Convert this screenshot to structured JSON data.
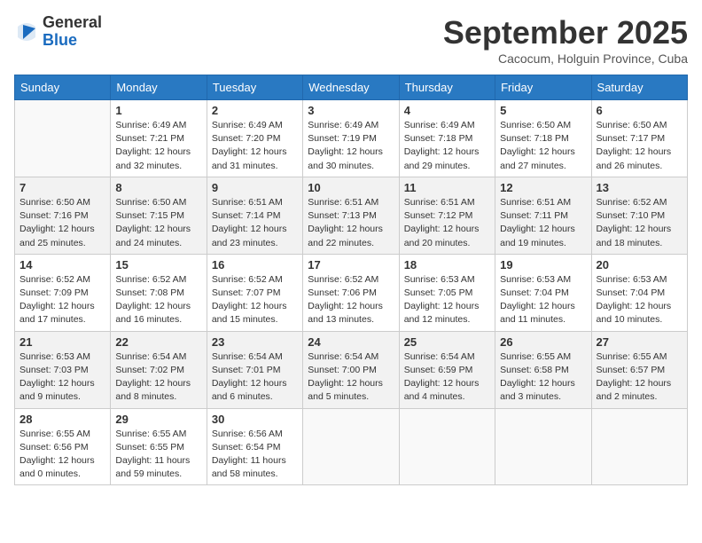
{
  "header": {
    "logo_general": "General",
    "logo_blue": "Blue",
    "month": "September 2025",
    "location": "Cacocum, Holguin Province, Cuba"
  },
  "weekdays": [
    "Sunday",
    "Monday",
    "Tuesday",
    "Wednesday",
    "Thursday",
    "Friday",
    "Saturday"
  ],
  "weeks": [
    [
      {
        "day": "",
        "info": ""
      },
      {
        "day": "1",
        "info": "Sunrise: 6:49 AM\nSunset: 7:21 PM\nDaylight: 12 hours\nand 32 minutes."
      },
      {
        "day": "2",
        "info": "Sunrise: 6:49 AM\nSunset: 7:20 PM\nDaylight: 12 hours\nand 31 minutes."
      },
      {
        "day": "3",
        "info": "Sunrise: 6:49 AM\nSunset: 7:19 PM\nDaylight: 12 hours\nand 30 minutes."
      },
      {
        "day": "4",
        "info": "Sunrise: 6:49 AM\nSunset: 7:18 PM\nDaylight: 12 hours\nand 29 minutes."
      },
      {
        "day": "5",
        "info": "Sunrise: 6:50 AM\nSunset: 7:18 PM\nDaylight: 12 hours\nand 27 minutes."
      },
      {
        "day": "6",
        "info": "Sunrise: 6:50 AM\nSunset: 7:17 PM\nDaylight: 12 hours\nand 26 minutes."
      }
    ],
    [
      {
        "day": "7",
        "info": "Sunrise: 6:50 AM\nSunset: 7:16 PM\nDaylight: 12 hours\nand 25 minutes."
      },
      {
        "day": "8",
        "info": "Sunrise: 6:50 AM\nSunset: 7:15 PM\nDaylight: 12 hours\nand 24 minutes."
      },
      {
        "day": "9",
        "info": "Sunrise: 6:51 AM\nSunset: 7:14 PM\nDaylight: 12 hours\nand 23 minutes."
      },
      {
        "day": "10",
        "info": "Sunrise: 6:51 AM\nSunset: 7:13 PM\nDaylight: 12 hours\nand 22 minutes."
      },
      {
        "day": "11",
        "info": "Sunrise: 6:51 AM\nSunset: 7:12 PM\nDaylight: 12 hours\nand 20 minutes."
      },
      {
        "day": "12",
        "info": "Sunrise: 6:51 AM\nSunset: 7:11 PM\nDaylight: 12 hours\nand 19 minutes."
      },
      {
        "day": "13",
        "info": "Sunrise: 6:52 AM\nSunset: 7:10 PM\nDaylight: 12 hours\nand 18 minutes."
      }
    ],
    [
      {
        "day": "14",
        "info": "Sunrise: 6:52 AM\nSunset: 7:09 PM\nDaylight: 12 hours\nand 17 minutes."
      },
      {
        "day": "15",
        "info": "Sunrise: 6:52 AM\nSunset: 7:08 PM\nDaylight: 12 hours\nand 16 minutes."
      },
      {
        "day": "16",
        "info": "Sunrise: 6:52 AM\nSunset: 7:07 PM\nDaylight: 12 hours\nand 15 minutes."
      },
      {
        "day": "17",
        "info": "Sunrise: 6:52 AM\nSunset: 7:06 PM\nDaylight: 12 hours\nand 13 minutes."
      },
      {
        "day": "18",
        "info": "Sunrise: 6:53 AM\nSunset: 7:05 PM\nDaylight: 12 hours\nand 12 minutes."
      },
      {
        "day": "19",
        "info": "Sunrise: 6:53 AM\nSunset: 7:04 PM\nDaylight: 12 hours\nand 11 minutes."
      },
      {
        "day": "20",
        "info": "Sunrise: 6:53 AM\nSunset: 7:04 PM\nDaylight: 12 hours\nand 10 minutes."
      }
    ],
    [
      {
        "day": "21",
        "info": "Sunrise: 6:53 AM\nSunset: 7:03 PM\nDaylight: 12 hours\nand 9 minutes."
      },
      {
        "day": "22",
        "info": "Sunrise: 6:54 AM\nSunset: 7:02 PM\nDaylight: 12 hours\nand 8 minutes."
      },
      {
        "day": "23",
        "info": "Sunrise: 6:54 AM\nSunset: 7:01 PM\nDaylight: 12 hours\nand 6 minutes."
      },
      {
        "day": "24",
        "info": "Sunrise: 6:54 AM\nSunset: 7:00 PM\nDaylight: 12 hours\nand 5 minutes."
      },
      {
        "day": "25",
        "info": "Sunrise: 6:54 AM\nSunset: 6:59 PM\nDaylight: 12 hours\nand 4 minutes."
      },
      {
        "day": "26",
        "info": "Sunrise: 6:55 AM\nSunset: 6:58 PM\nDaylight: 12 hours\nand 3 minutes."
      },
      {
        "day": "27",
        "info": "Sunrise: 6:55 AM\nSunset: 6:57 PM\nDaylight: 12 hours\nand 2 minutes."
      }
    ],
    [
      {
        "day": "28",
        "info": "Sunrise: 6:55 AM\nSunset: 6:56 PM\nDaylight: 12 hours\nand 0 minutes."
      },
      {
        "day": "29",
        "info": "Sunrise: 6:55 AM\nSunset: 6:55 PM\nDaylight: 11 hours\nand 59 minutes."
      },
      {
        "day": "30",
        "info": "Sunrise: 6:56 AM\nSunset: 6:54 PM\nDaylight: 11 hours\nand 58 minutes."
      },
      {
        "day": "",
        "info": ""
      },
      {
        "day": "",
        "info": ""
      },
      {
        "day": "",
        "info": ""
      },
      {
        "day": "",
        "info": ""
      }
    ]
  ]
}
